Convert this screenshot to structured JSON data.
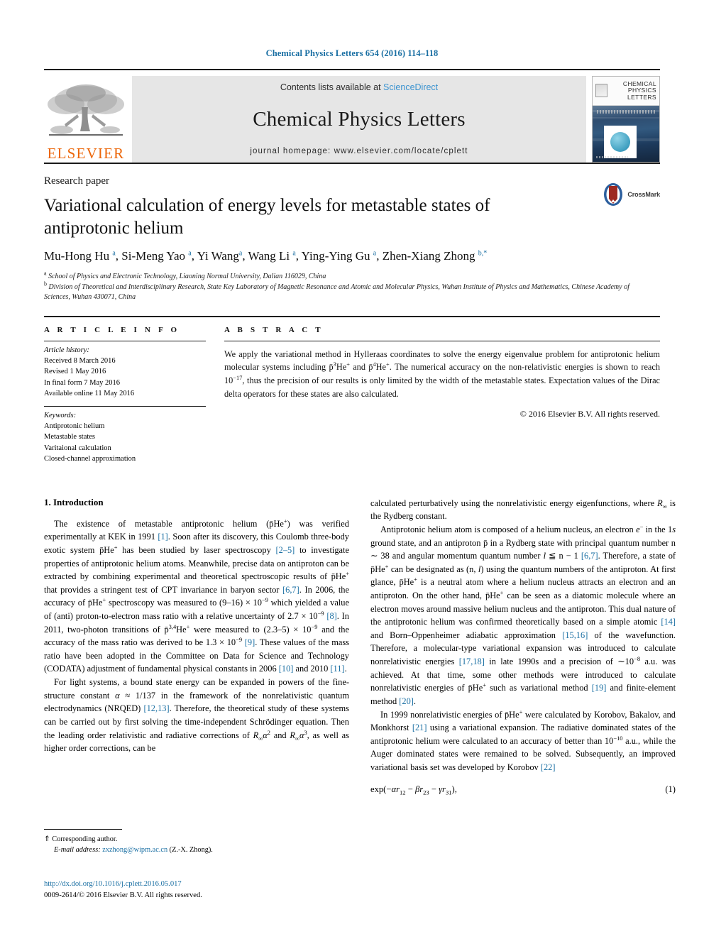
{
  "running_head": "Chemical Physics Letters 654 (2016) 114–118",
  "masthead": {
    "publisher_name": "ELSEVIER",
    "contents_prefix": "Contents lists available at ",
    "sciencedirect": "ScienceDirect",
    "journal_name": "Chemical Physics Letters",
    "homepage": "journal homepage: www.elsevier.com/locate/cplett",
    "cover_title": "CHEMICAL PHYSICS LETTERS"
  },
  "article": {
    "kicker": "Research paper",
    "title": "Variational calculation of energy levels for metastable states of antiprotonic helium",
    "crossmark_label": "CrossMark",
    "authors_html": "Mu-Hong Hu <sup>a</sup>, Si-Meng Yao <sup>a</sup>, Yi Wang<sup>a</sup>, Wang Li <sup>a</sup>, Ying-Ying Gu <sup>a</sup>, Zhen-Xiang Zhong <sup>b,*</sup>",
    "affiliations": [
      "School of Physics and Electronic Technology, Liaoning Normal University, Dalian 116029, China",
      "Division of Theoretical and Interdisciplinary Research, State Key Laboratory of Magnetic Resonance and Atomic and Molecular Physics, Wuhan Institute of Physics and Mathematics, Chinese Academy of Sciences, Wuhan 430071, China"
    ]
  },
  "info": {
    "heading": "A R T I C L E    I N F O",
    "history_label": "Article history:",
    "history": [
      "Received 8 March 2016",
      "Revised 1 May 2016",
      "In final form 7 May 2016",
      "Available online 11 May 2016"
    ],
    "keywords_label": "Keywords:",
    "keywords": [
      "Antiprotonic helium",
      "Metastable states",
      "Varitaional calculation",
      "Closed-channel approximation"
    ]
  },
  "abstract": {
    "heading": "A B S T R A C T",
    "text_html": "We apply the variational method in Hylleraas coordinates to solve the energy eigenvalue problem for antiprotonic helium molecular systems including p&#772;<sup>3</sup>He<sup>+</sup> and p&#772;<sup>4</sup>He<sup>+</sup>. The numerical accuracy on the non-relativistic energies is shown to reach 10<sup>&#8722;17</sup>, thus the precision of our results is only limited by the width of the metastable states. Expectation values of the Dirac delta operators for these states are also calculated.",
    "copyright": "© 2016 Elsevier B.V. All rights reserved."
  },
  "body": {
    "section_title": "1. Introduction",
    "left_paragraphs_html": [
      "The existence of metastable antiprotonic helium (p&#772;He<sup>+</sup>) was verified experimentally at KEK in 1991 <span class=\"ref\">[1]</span>. Soon after its discovery, this Coulomb three-body exotic system p&#772;He<sup>+</sup> has been studied by laser spectroscopy <span class=\"ref\">[2&#8211;5]</span> to investigate properties of antiprotonic helium atoms. Meanwhile, precise data on antiproton can be extracted by combining experimental and theoretical spectroscopic results of p&#772;He<sup>+</sup> that provides a stringent test of CPT invariance in baryon sector <span class=\"ref\">[6,7]</span>. In 2006, the accuracy of p&#772;He<sup>+</sup> spectroscopy was measured to (9&#8211;16) &#215; 10<sup>&#8722;9</sup> which yielded a value of (anti) proton-to-electron mass ratio with a relative uncertainty of 2.7 &#215; 10<sup>&#8722;9</sup> <span class=\"ref\">[8]</span>. In 2011, two-photon transitions of p&#772;<sup>3,4</sup>He<sup>+</sup> were measured to (2.3&#8211;5) &#215; 10<sup>&#8722;9</sup> and the accuracy of the mass ratio was derived to be 1.3 &#215; 10<sup>&#8722;9</sup> <span class=\"ref\">[9]</span>. These values of the mass ratio have been adopted in the Committee on Data for Science and Technology (CODATA) adjustment of fundamental physical constants in 2006 <span class=\"ref\">[10]</span> and 2010 <span class=\"ref\">[11]</span>.",
      "For light systems, a bound state energy can be expanded in powers of the fine-structure constant <span class=\"ital\">&#945;</span> &#8776; 1/137 in the framework of the nonrelativistic quantum electrodynamics (NRQED) <span class=\"ref\">[12,13]</span>. Therefore, the theoretical study of these systems can be carried out by first solving the time-independent Schr&#246;dinger equation. Then the leading order relativistic and radiative corrections of <span class=\"ital\">R<sub>&#8734;</sub>&#945;</span><sup>2</sup> and <span class=\"ital\">R<sub>&#8734;</sub>&#945;</span><sup>3</sup>, as well as higher order corrections, can be"
    ],
    "right_paragraphs_html": [
      "calculated perturbatively using the nonrelativistic energy eigenfunctions, where <span class=\"ital\">R<sub>&#8734;</sub></span> is the Rydberg constant.",
      "Antiprotonic helium atom is composed of a helium nucleus, an electron <span class=\"ital\">e</span><sup>&#8722;</sup> in the 1<span class=\"ital\">s</span> ground state, and an antiproton p&#772; in a Rydberg state with principal quantum number n &#8764; 38 and angular momentum quantum number <span class=\"ital\">l</span> &#8806; n &#8722; 1 <span class=\"ref\">[6,7]</span>. Therefore, a state of p&#772;He<sup>+</sup> can be designated as (n, <span class=\"ital\">l</span>) using the quantum numbers of the antiproton. At first glance, p&#772;He<sup>+</sup> is a neutral atom where a helium nucleus attracts an electron and an antiproton. On the other hand, p&#772;He<sup>+</sup> can be seen as a diatomic molecule where an electron moves around massive helium nucleus and the antiproton. This dual nature of the antiprotonic helium was confirmed theoretically based on a simple atomic <span class=\"ref\">[14]</span> and Born&#8211;Oppenheimer adiabatic approximation <span class=\"ref\">[15,16]</span> of the wavefunction. Therefore, a molecular-type variational expansion was introduced to calculate nonrelativistic energies <span class=\"ref\">[17,18]</span> in late 1990s and a precision of &#8764;10<sup>&#8722;8</sup> a.u. was achieved. At that time, some other methods were introduced to calculate nonrelativistic energies of p&#772;He<sup>+</sup> such as variational method <span class=\"ref\">[19]</span> and finite-element method <span class=\"ref\">[20]</span>.",
      "In 1999 nonrelativistic energies of p&#772;He<sup>+</sup> were calculated by Korobov, Bakalov, and Monkhorst <span class=\"ref\">[21]</span> using a variational expansion. The radiative dominated states of the antiprotonic helium were calculated to an accuracy of better than 10<sup>&#8722;10</sup> a.u., while the Auger dominated states were remained to be solved. Subsequently, an improved variational basis set was developed by Korobov <span class=\"ref\">[22]</span>"
    ],
    "equation_html": "exp(&#8722;<span class=\"ital\">&#945;r</span><sub>12</sub> &#8722; <span class=\"ital\">&#946;r</span><sub>23</sub> &#8722; <span class=\"ital\">&#947;r</span><sub>31</sub>),",
    "equation_number": "(1)"
  },
  "footnote": {
    "corresponding_marker": "⇑",
    "corresponding_text": "Corresponding author.",
    "email_label": "E-mail address:",
    "email": "zxzhong@wipm.ac.cn",
    "email_owner": "(Z.-X. Zhong)."
  },
  "page_footer": {
    "doi": "http://dx.doi.org/10.1016/j.cplett.2016.05.017",
    "issn_line": "0009-2614/© 2016 Elsevier B.V. All rights reserved."
  },
  "colors": {
    "link": "#1a6fa3",
    "elsevier_orange": "#ec6608",
    "sciencedirect": "#3b93d0",
    "band_bg": "#e6e6e6"
  }
}
